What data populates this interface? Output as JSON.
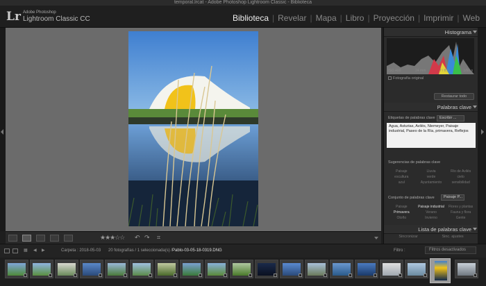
{
  "window": {
    "title": "temporal.lrcat - Adobe Photoshop Lightroom Classic - Biblioteca"
  },
  "app": {
    "logo": "Lr",
    "vendor": "Adobe Photoshop",
    "name": "Lightroom Classic CC"
  },
  "modules": [
    {
      "label": "Biblioteca",
      "active": true
    },
    {
      "label": "Revelar",
      "active": false
    },
    {
      "label": "Mapa",
      "active": false
    },
    {
      "label": "Libro",
      "active": false
    },
    {
      "label": "Proyección",
      "active": false
    },
    {
      "label": "Imprimir",
      "active": false
    },
    {
      "label": "Web",
      "active": false
    }
  ],
  "right_panel": {
    "histogram": {
      "title": "Histograma",
      "iso": "ISO 400",
      "focal": "24 mm",
      "aperture": "f / 8,0",
      "shutter": "1/60 s",
      "original_photo": "Fotografía original"
    },
    "restore_all": "Restaurar todo",
    "keywords": {
      "title": "Palabras clave",
      "tags_label": "Etiquetas de palabras clave",
      "mode": "Escribir ...",
      "value": "Agua, Asturias, Avilés, Niemeyer, Paisaje industrial, Paseo de la Ría, primavera, Reflejos"
    },
    "suggestions": {
      "title": "Sugerencias de palabras clave",
      "items": [
        "Paisaje",
        "Lluvia",
        "Río de Avilés",
        "escultura",
        "verde",
        "cielo",
        "azul",
        "Ayuntamiento",
        "sensibilidad"
      ]
    },
    "keyword_set": {
      "title": "Conjunto de palabras clave",
      "preset": "Paisaje P...",
      "items": [
        {
          "label": "Paisaje",
          "active": false
        },
        {
          "label": "Paisaje industrial",
          "active": true
        },
        {
          "label": "Flores y plantas",
          "active": false
        },
        {
          "label": "Primavera",
          "active": true
        },
        {
          "label": "Verano",
          "active": false
        },
        {
          "label": "Fauna y flora",
          "active": false
        },
        {
          "label": "Otoño",
          "active": false
        },
        {
          "label": "Invierno",
          "active": false
        },
        {
          "label": "Gente",
          "active": false
        }
      ]
    },
    "keyword_list": {
      "title": "Lista de palabras clave"
    },
    "sync_meta": "Sincronizar",
    "sync_settings": "Sinc. ajustes"
  },
  "toolbar": {
    "stars": "★★★☆☆"
  },
  "filmstrip_bar": {
    "folder": "Carpeta : 2018-05-03",
    "count": "20 fotografías / 1 seleccionada(s) /",
    "file": "Pablo-03-05-18-0319.DNG",
    "filter_label": "Filtro :",
    "filter_value": "Filtros desactivados"
  },
  "colors": {
    "accent": "#e8e8e8",
    "panel_bg": "#2b2b2b",
    "center_bg": "#6b6b6b"
  },
  "icons": [
    "grid-view-icon",
    "loupe-view-icon",
    "compare-view-icon",
    "survey-view-icon",
    "people-view-icon",
    "rotate-left-icon",
    "rotate-right-icon",
    "crop-icon"
  ]
}
